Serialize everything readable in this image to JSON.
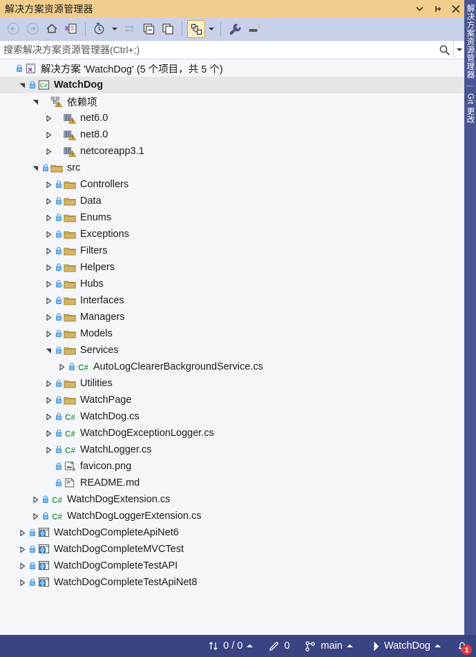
{
  "window": {
    "title": "解决方案资源管理器",
    "buttons": [
      {
        "name": "window-dropdown",
        "icon": "chevron-down-icon"
      },
      {
        "name": "window-pin",
        "icon": "pin-icon"
      },
      {
        "name": "window-close",
        "icon": "close-icon"
      }
    ]
  },
  "toolbar": {
    "items": [
      {
        "name": "back-button",
        "icon": "arrow-back-icon",
        "disabled": true
      },
      {
        "name": "forward-button",
        "icon": "arrow-forward-icon",
        "disabled": true
      },
      {
        "name": "home-button",
        "icon": "home-icon"
      },
      {
        "name": "solution-explorer-button",
        "icon": "solution-explorer-icon"
      },
      {
        "name": "pending-changes-button",
        "icon": "clock-icon"
      },
      {
        "name": "sync-with-active-document-button",
        "icon": "sync-arrows-icon",
        "disabled": true
      },
      {
        "name": "collapse-all-button",
        "icon": "collapse-all-icon"
      },
      {
        "name": "show-all-files-button",
        "icon": "show-all-files-icon"
      },
      {
        "name": "view-code-map-button",
        "icon": "code-map-icon",
        "active": true
      },
      {
        "name": "properties-button",
        "icon": "wrench-icon"
      },
      {
        "name": "preview-selected-items-button",
        "icon": "preview-icon"
      }
    ]
  },
  "search": {
    "placeholder": "搜索解决方案资源管理器(Ctrl+;)",
    "value": "",
    "icon": "magnifier-icon",
    "caret": "chevron-down-icon"
  },
  "tree": [
    {
      "label": "解决方案 'WatchDog' (5 个项目，共 5 个)",
      "indent": 0,
      "twisty": "none",
      "lock": true,
      "icon": "solution-icon",
      "bold": false,
      "highlight": false
    },
    {
      "label": "WatchDog",
      "indent": 1,
      "twisty": "expanded",
      "lock": true,
      "icon": "csharp-project-icon",
      "bold": true,
      "highlight": true
    },
    {
      "label": "依赖项",
      "indent": 2,
      "twisty": "expanded",
      "lock": false,
      "icon": "dependencies-warning-icon",
      "bold": false,
      "highlight": false
    },
    {
      "label": "net6.0",
      "indent": 3,
      "twisty": "collapsed",
      "lock": false,
      "icon": "framework-warning-icon",
      "bold": false,
      "highlight": false
    },
    {
      "label": "net8.0",
      "indent": 3,
      "twisty": "collapsed",
      "lock": false,
      "icon": "framework-warning-icon",
      "bold": false,
      "highlight": false
    },
    {
      "label": "netcoreapp3.1",
      "indent": 3,
      "twisty": "collapsed",
      "lock": false,
      "icon": "framework-warning-icon",
      "bold": false,
      "highlight": false
    },
    {
      "label": "src",
      "indent": 2,
      "twisty": "expanded",
      "lock": true,
      "icon": "folder-icon",
      "bold": false,
      "highlight": false
    },
    {
      "label": "Controllers",
      "indent": 3,
      "twisty": "collapsed",
      "lock": true,
      "icon": "folder-icon",
      "bold": false,
      "highlight": false
    },
    {
      "label": "Data",
      "indent": 3,
      "twisty": "collapsed",
      "lock": true,
      "icon": "folder-icon",
      "bold": false,
      "highlight": false
    },
    {
      "label": "Enums",
      "indent": 3,
      "twisty": "collapsed",
      "lock": true,
      "icon": "folder-icon",
      "bold": false,
      "highlight": false
    },
    {
      "label": "Exceptions",
      "indent": 3,
      "twisty": "collapsed",
      "lock": true,
      "icon": "folder-icon",
      "bold": false,
      "highlight": false
    },
    {
      "label": "Filters",
      "indent": 3,
      "twisty": "collapsed",
      "lock": true,
      "icon": "folder-icon",
      "bold": false,
      "highlight": false
    },
    {
      "label": "Helpers",
      "indent": 3,
      "twisty": "collapsed",
      "lock": true,
      "icon": "folder-icon",
      "bold": false,
      "highlight": false
    },
    {
      "label": "Hubs",
      "indent": 3,
      "twisty": "collapsed",
      "lock": true,
      "icon": "folder-icon",
      "bold": false,
      "highlight": false
    },
    {
      "label": "Interfaces",
      "indent": 3,
      "twisty": "collapsed",
      "lock": true,
      "icon": "folder-icon",
      "bold": false,
      "highlight": false
    },
    {
      "label": "Managers",
      "indent": 3,
      "twisty": "collapsed",
      "lock": true,
      "icon": "folder-icon",
      "bold": false,
      "highlight": false
    },
    {
      "label": "Models",
      "indent": 3,
      "twisty": "collapsed",
      "lock": true,
      "icon": "folder-icon",
      "bold": false,
      "highlight": false
    },
    {
      "label": "Services",
      "indent": 3,
      "twisty": "expanded",
      "lock": true,
      "icon": "folder-icon",
      "bold": false,
      "highlight": false
    },
    {
      "label": "AutoLogClearerBackgroundService.cs",
      "indent": 4,
      "twisty": "collapsed",
      "lock": true,
      "icon": "csharp-file-icon",
      "bold": false,
      "highlight": false
    },
    {
      "label": "Utilities",
      "indent": 3,
      "twisty": "collapsed",
      "lock": true,
      "icon": "folder-icon",
      "bold": false,
      "highlight": false
    },
    {
      "label": "WatchPage",
      "indent": 3,
      "twisty": "collapsed",
      "lock": true,
      "icon": "folder-icon",
      "bold": false,
      "highlight": false
    },
    {
      "label": "WatchDog.cs",
      "indent": 3,
      "twisty": "collapsed",
      "lock": true,
      "icon": "csharp-file-icon",
      "bold": false,
      "highlight": false
    },
    {
      "label": "WatchDogExceptionLogger.cs",
      "indent": 3,
      "twisty": "collapsed",
      "lock": true,
      "icon": "csharp-file-icon",
      "bold": false,
      "highlight": false
    },
    {
      "label": "WatchLogger.cs",
      "indent": 3,
      "twisty": "collapsed",
      "lock": true,
      "icon": "csharp-file-icon",
      "bold": false,
      "highlight": false
    },
    {
      "label": "favicon.png",
      "indent": 3,
      "twisty": "none",
      "lock": true,
      "icon": "image-file-icon",
      "bold": false,
      "highlight": false
    },
    {
      "label": "README.md",
      "indent": 3,
      "twisty": "none",
      "lock": true,
      "icon": "markdown-file-icon",
      "bold": false,
      "highlight": false
    },
    {
      "label": "WatchDogExtension.cs",
      "indent": 2,
      "twisty": "collapsed",
      "lock": true,
      "icon": "csharp-file-icon",
      "bold": false,
      "highlight": false
    },
    {
      "label": "WatchDogLoggerExtension.cs",
      "indent": 2,
      "twisty": "collapsed",
      "lock": true,
      "icon": "csharp-file-icon",
      "bold": false,
      "highlight": false
    },
    {
      "label": "WatchDogCompleteApiNet6",
      "indent": 1,
      "twisty": "collapsed",
      "lock": true,
      "icon": "web-project-icon",
      "bold": false,
      "highlight": false
    },
    {
      "label": "WatchDogCompleteMVCTest",
      "indent": 1,
      "twisty": "collapsed",
      "lock": true,
      "icon": "web-project-icon",
      "bold": false,
      "highlight": false
    },
    {
      "label": "WatchDogCompleteTestAPI",
      "indent": 1,
      "twisty": "collapsed",
      "lock": true,
      "icon": "web-project-icon",
      "bold": false,
      "highlight": false
    },
    {
      "label": "WatchDogCompleteTestApiNet8",
      "indent": 1,
      "twisty": "collapsed",
      "lock": true,
      "icon": "web-project-icon",
      "bold": false,
      "highlight": false
    }
  ],
  "rail": {
    "tabs": [
      {
        "name": "solution-explorer-tab",
        "label": "解决方案资源管理器"
      },
      {
        "name": "git-changes-tab",
        "label": "Git 更改"
      }
    ]
  },
  "statusbar": {
    "sync": {
      "icon": "up-down-arrows-icon",
      "text": "0 / 0",
      "caret": "chevron-up-icon"
    },
    "pending_changes": {
      "icon": "pencil-icon",
      "text": "0"
    },
    "branch": {
      "icon": "branch-icon",
      "text": "main",
      "caret": "chevron-up-icon"
    },
    "repository": {
      "icon": "diamond-icon",
      "text": "WatchDog",
      "caret": "chevron-up-icon"
    },
    "notifications": {
      "icon": "bell-icon",
      "count": "1",
      "badge_color": "#e03b3b"
    }
  },
  "colors": {
    "title_bar": "#f2cd8b",
    "toolbar": "#c9d1ea",
    "tree_bg": "#f5f6fa",
    "status_bar": "#3b4483",
    "rail": "#4a5694",
    "folder": "#c8a85a",
    "csharp_green": "#3a9e53",
    "selection": "#e6e6e6"
  }
}
